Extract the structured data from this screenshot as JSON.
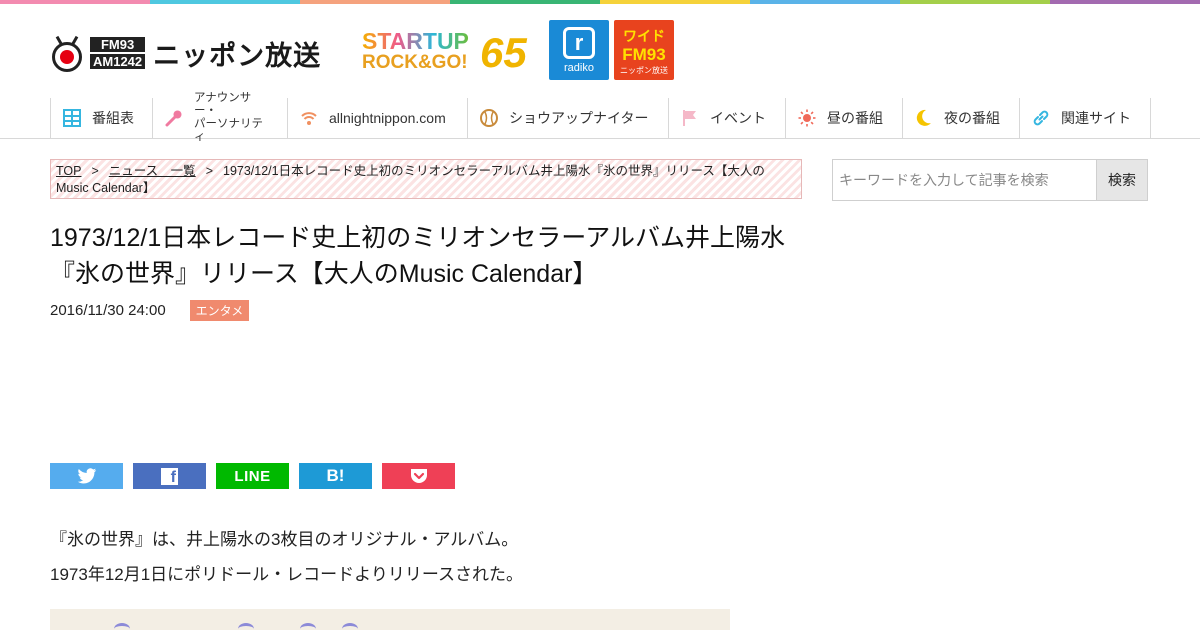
{
  "stripe_colors": [
    "#f38bb0",
    "#4fc8e0",
    "#f5a27e",
    "#39b574",
    "#f5d23a",
    "#5ab3e8",
    "#a4cf4a",
    "#a36ab0"
  ],
  "header": {
    "logo": {
      "fm": "FM93",
      "am": "AM1242",
      "brand": "ニッポン放送"
    },
    "campaign": {
      "line1": "STARTUP",
      "line2": "ROCK&GO!",
      "number": "65"
    },
    "radiko": {
      "label": "radiko",
      "glyph": "r"
    },
    "wide": {
      "line1": "ワイド",
      "line2": "FM93",
      "line3": "ニッポン放送"
    }
  },
  "nav": {
    "items": [
      {
        "label": "番組表",
        "icon": "grid-icon"
      },
      {
        "label_l1": "アナウンサー・",
        "label_l2": "パーソナリティ",
        "icon": "microphone-icon"
      },
      {
        "label": "allnightnippon.com",
        "icon": "wifi-icon"
      },
      {
        "label": "ショウアップナイター",
        "icon": "baseball-icon"
      },
      {
        "label": "イベント",
        "icon": "flag-icon"
      },
      {
        "label": "昼の番組",
        "icon": "sun-icon"
      },
      {
        "label": "夜の番組",
        "icon": "moon-icon"
      },
      {
        "label": "関連サイト",
        "icon": "link-icon"
      }
    ]
  },
  "breadcrumb": {
    "top": "TOP",
    "sep": ">",
    "news": "ニュース　一覧",
    "current": "1973/12/1日本レコード史上初のミリオンセラーアルバム井上陽水『氷の世界』リリース【大人のMusic Calendar】"
  },
  "article": {
    "title": "1973/12/1日本レコード史上初のミリオンセラーアルバム井上陽水『氷の世界』リリース【大人のMusic Calendar】",
    "date": "2016/11/30 24:00",
    "category": "エンタメ",
    "paragraph1": "『氷の世界』は、井上陽水の3枚目のオリジナル・アルバム。",
    "paragraph2": "1973年12月1日にポリドール・レコードよりリリースされた。"
  },
  "share": {
    "twitter": {
      "color": "#55acee",
      "icon": "twitter-bird-icon"
    },
    "facebook": {
      "color": "#4a6fbf",
      "icon": "facebook-icon",
      "glyph": "f"
    },
    "line": {
      "color": "#00b900",
      "label": "LINE"
    },
    "hatena": {
      "color": "#1e9ad6",
      "label": "B!"
    },
    "pocket": {
      "color": "#ef4056",
      "icon": "pocket-icon"
    }
  },
  "search": {
    "placeholder": "キーワードを入力して記事を検索",
    "button": "検索"
  }
}
